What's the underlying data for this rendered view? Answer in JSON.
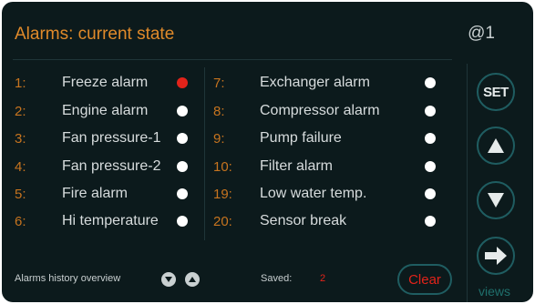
{
  "header": {
    "title": "Alarms: current state",
    "device_id": "@1"
  },
  "alarms_left": [
    {
      "num": "1:",
      "label": "Freeze alarm",
      "active": true
    },
    {
      "num": "2:",
      "label": "Engine alarm",
      "active": false
    },
    {
      "num": "3:",
      "label": "Fan pressure-1",
      "active": false
    },
    {
      "num": "4:",
      "label": "Fan pressure-2",
      "active": false
    },
    {
      "num": "5:",
      "label": "Fire alarm",
      "active": false
    },
    {
      "num": "6:",
      "label": "Hi temperature",
      "active": false
    }
  ],
  "alarms_right": [
    {
      "num": "7:",
      "label": "Exchanger alarm",
      "active": false
    },
    {
      "num": "8:",
      "label": "Compressor alarm",
      "active": false
    },
    {
      "num": "9:",
      "label": "Pump failure",
      "active": false
    },
    {
      "num": "10:",
      "label": "Filter alarm",
      "active": false
    },
    {
      "num": "19:",
      "label": "Low water temp.",
      "active": false
    },
    {
      "num": "20:",
      "label": "Sensor break",
      "active": false
    }
  ],
  "footer": {
    "history_label": "Alarms history overview",
    "saved_label": "Saved:",
    "saved_count": "2",
    "clear_label": "Clear"
  },
  "side": {
    "set_label": "SET",
    "views_label": "views"
  },
  "colors": {
    "active": "#e2231a",
    "inactive": "#ffffff",
    "number": "#c7741f",
    "accent": "#1f5d61"
  }
}
